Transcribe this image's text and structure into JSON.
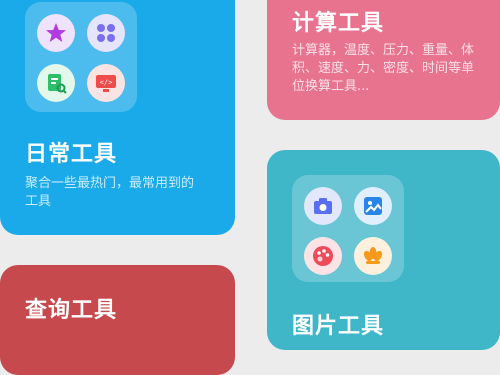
{
  "cards": {
    "daily": {
      "title": "日常工具",
      "desc": "聚合一些最热门，最常用到的工具",
      "color": "#1aaaea",
      "icons": [
        "star-app-icon",
        "grid-app-icon",
        "document-search-app-icon",
        "code-monitor-app-icon"
      ]
    },
    "calc": {
      "title": "计算工具",
      "desc": "计算器，温度、压力、重量、体积、速度、力、密度、时间等单位换算工具...",
      "color": "#e8738f"
    },
    "query": {
      "title": "查询工具",
      "desc": "",
      "color": "#c64a4d"
    },
    "image": {
      "title": "图片工具",
      "color": "#40b6c9",
      "icons": [
        "camera-app-icon",
        "photo-app-icon",
        "palette-app-icon",
        "flower-app-icon"
      ]
    }
  }
}
